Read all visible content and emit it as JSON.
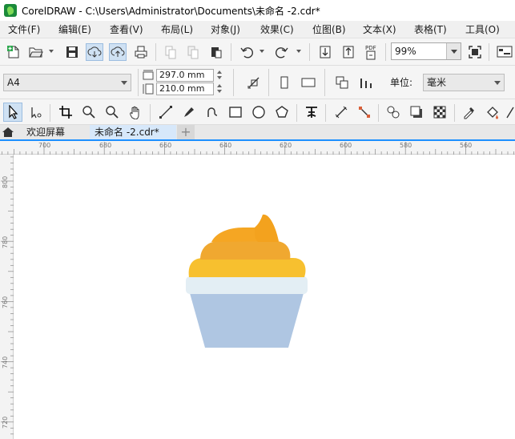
{
  "window": {
    "title": "CorelDRAW - C:\\Users\\Administrator\\Documents\\未命名 -2.cdr*"
  },
  "menu": [
    {
      "label": "文件(F)"
    },
    {
      "label": "编辑(E)"
    },
    {
      "label": "查看(V)"
    },
    {
      "label": "布局(L)"
    },
    {
      "label": "对象(J)"
    },
    {
      "label": "效果(C)"
    },
    {
      "label": "位图(B)"
    },
    {
      "label": "文本(X)"
    },
    {
      "label": "表格(T)"
    },
    {
      "label": "工具(O)"
    }
  ],
  "toolbar": {
    "zoom_value": "99%",
    "pdf_label": "PDF"
  },
  "property_bar": {
    "page_size": "A4",
    "width": "297.0 mm",
    "height": "210.0 mm",
    "unit_label": "单位:",
    "unit_value": "毫米"
  },
  "tabs": {
    "welcome": "欢迎屏幕",
    "document": "未命名 -2.cdr*",
    "add": "+"
  },
  "ruler_h": {
    "labels": [
      "700",
      "680",
      "660",
      "640",
      "620",
      "600",
      "580",
      "560"
    ]
  },
  "ruler_v": {
    "labels": [
      "800",
      "780",
      "760",
      "740",
      "720"
    ]
  },
  "colors": {
    "cream_top": "#f5a623",
    "cream_mid": "#f0a830",
    "cream_bottom": "#f7c02f",
    "rim": "#e3eef4",
    "cup": "#afc6e2",
    "tab_underline": "#1e90ff"
  }
}
